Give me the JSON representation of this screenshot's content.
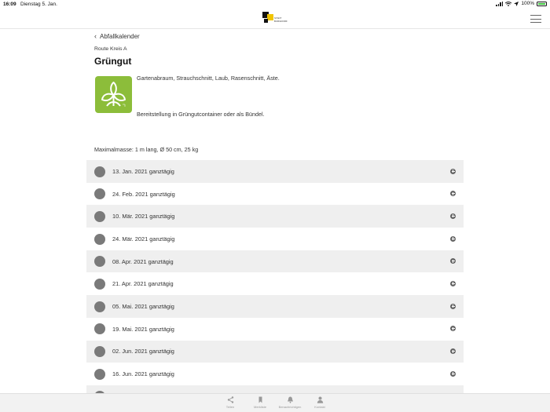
{
  "statusbar": {
    "time": "16:09",
    "date": "Dienstag 5. Jan.",
    "battery": "100%"
  },
  "header": {
    "logo_line1": "STADT",
    "logo_line2": "BURGDORF"
  },
  "nav": {
    "back_label": "Abfallkalender"
  },
  "content": {
    "route": "Route Kreis A",
    "title": "Grüngut",
    "description": "Gartenabraum, Strauchschnitt, Laub, Rasenschnitt, Äste.",
    "description2": "Bereitstellung in Grüngutcontainer oder als Bündel.",
    "max_mass": "Maximalmasse: 1 m lang, Ø 50 cm, 25 kg",
    "category_icon": "leaf-icon",
    "category_color": "#8cbd3a"
  },
  "dates": [
    "13. Jan. 2021 ganztägig",
    "24. Feb. 2021 ganztägig",
    "10. Mär. 2021 ganztägig",
    "24. Mär. 2021 ganztägig",
    "08. Apr. 2021 ganztägig",
    "21. Apr. 2021 ganztägig",
    "05. Mai. 2021 ganztägig",
    "19. Mai. 2021 ganztägig",
    "02. Jun. 2021 ganztägig",
    "16. Jun. 2021 ganztägig"
  ],
  "tabbar": {
    "tabs": [
      {
        "label": "Teilen",
        "icon": "share-icon"
      },
      {
        "label": "Merkliste",
        "icon": "bookmark-icon"
      },
      {
        "label": "Benachrichtigen",
        "icon": "bell-icon"
      },
      {
        "label": "Kontakt",
        "icon": "person-icon"
      }
    ]
  }
}
